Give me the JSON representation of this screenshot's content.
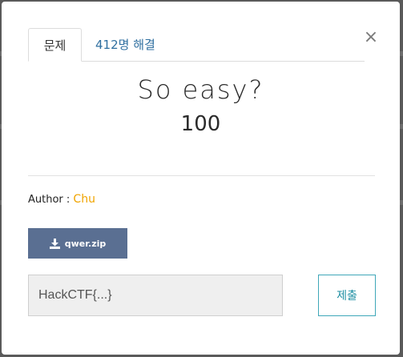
{
  "modal": {
    "close_icon": "×",
    "tabs": [
      {
        "label": "문제"
      },
      {
        "label": "412명 해결"
      }
    ],
    "challenge_title": "So easy?",
    "points": "100",
    "author_label": "Author : ",
    "author_name": "Chu",
    "download_label": "qwer.zip",
    "flag_placeholder": "HackCTF{...}",
    "submit_label": "제출"
  },
  "colors": {
    "author_accent": "#f0a400",
    "download_bg": "#5a6f92",
    "submit_accent": "#1f8fa3",
    "tab_link": "#2f6fa0"
  }
}
